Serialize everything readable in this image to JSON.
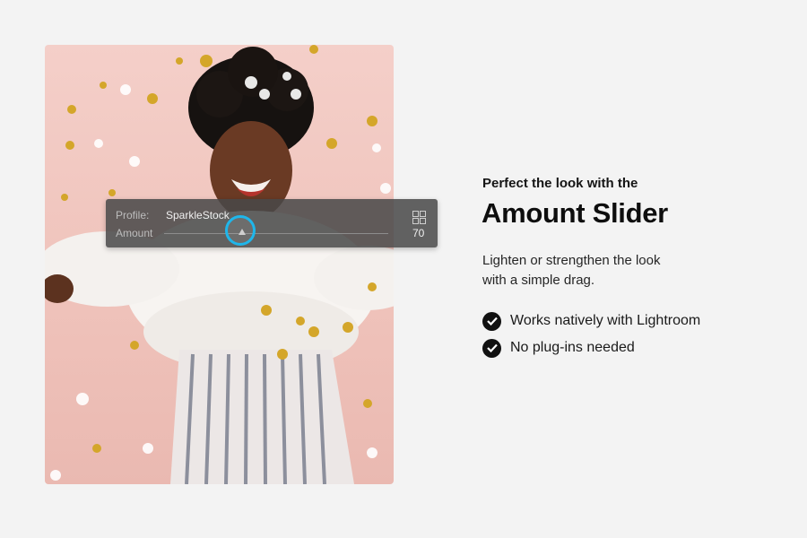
{
  "lightroom_panel": {
    "profile_label": "Profile:",
    "profile_value": "SparkleStock",
    "amount_label": "Amount",
    "amount_value": "70",
    "grid_icon": "grid-icon"
  },
  "content": {
    "kicker": "Perfect the look with the",
    "title": "Amount Slider",
    "description_line1": "Lighten or strengthen the look",
    "description_line2": "with a simple drag.",
    "features": [
      "Works natively with Lightroom",
      "No plug-ins needed"
    ]
  },
  "colors": {
    "accent": "#1fb6ea",
    "photo_background": "#f0c6bf",
    "page_background": "#f3f3f3"
  }
}
